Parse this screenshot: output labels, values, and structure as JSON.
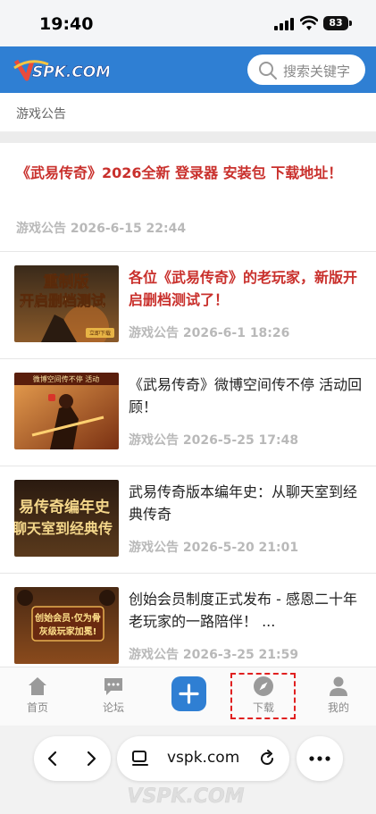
{
  "status_bar": {
    "time": "19:40",
    "battery": "83"
  },
  "header": {
    "logo_text": "VSPK.COM",
    "search_placeholder": "搜索关键字"
  },
  "breadcrumb": "游戏公告",
  "article": {
    "title": "《武易传奇》2026全新 登录器 安装包 下载地址！",
    "category": "游戏公告",
    "date": "2026-6-15 22:44"
  },
  "list": [
    {
      "title": "各位《武易传奇》的老玩家，新版开启删档测试了！",
      "category": "游戏公告",
      "date": "2026-6-1 18:26",
      "highlight": true,
      "thumb_text": [
        "重制版",
        "开启删档测试"
      ],
      "thumb_badge": "立即下载"
    },
    {
      "title": "《武易传奇》微博空间传不停 活动回顾！",
      "category": "游戏公告",
      "date": "2026-5-25 17:48",
      "highlight": false,
      "thumb_text": [
        "微博空间传不停 活动"
      ]
    },
    {
      "title": "武易传奇版本编年史：从聊天室到经典传奇",
      "category": "游戏公告",
      "date": "2026-5-20 21:01",
      "highlight": false,
      "thumb_text": [
        "易传奇编年史",
        "聊天室到经典传"
      ]
    },
    {
      "title": "创始会员制度正式发布 - 感恩二十年老玩家的一路陪伴！ ...",
      "category": "游戏公告",
      "date": "2026-3-25 21:59",
      "highlight": false,
      "thumb_text": [
        "创始会员·仅为骨",
        "灰级玩家加冕!"
      ]
    }
  ],
  "bottom_nav": [
    {
      "label": "首页",
      "icon": "home-icon"
    },
    {
      "label": "论坛",
      "icon": "chat-icon"
    },
    {
      "label": "",
      "icon": "plus-icon"
    },
    {
      "label": "下载",
      "icon": "compass-icon"
    },
    {
      "label": "我的",
      "icon": "user-icon"
    }
  ],
  "browser": {
    "url": "vspk.com",
    "watermark": "VSPK.COM"
  },
  "colors": {
    "brand_blue": "#2f7fd3",
    "title_red": "#c9302c",
    "meta_gray": "#b9b9b9",
    "highlight_red": "#e02020"
  }
}
